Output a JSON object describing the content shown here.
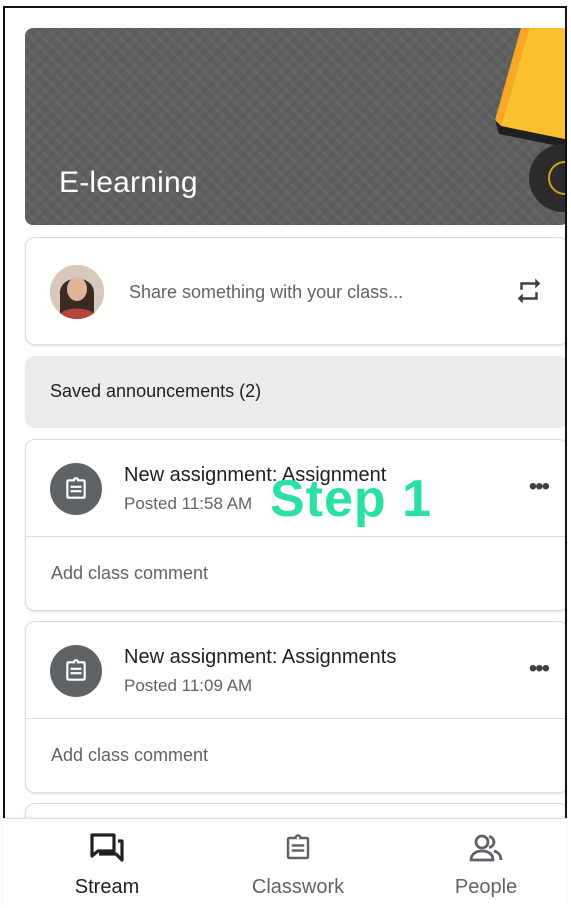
{
  "banner": {
    "title": "E-learning"
  },
  "share": {
    "placeholder": "Share something with your class..."
  },
  "saved": {
    "label": "Saved announcements (2)"
  },
  "posts": [
    {
      "title": "New assignment: Assignment",
      "time": "Posted 11:58 AM",
      "comment": "Add class comment"
    },
    {
      "title": "New assignment: Assignments",
      "time": "Posted 11:09 AM",
      "comment": "Add class comment"
    }
  ],
  "annotation": {
    "step": "Step 1"
  },
  "nav": {
    "stream": "Stream",
    "classwork": "Classwork",
    "people": "People"
  },
  "colors": {
    "banner": "#5f5f5f",
    "accent_yellow": "#fbc02d",
    "step_label": "#2be0a6",
    "icon_dark": "#5f6368"
  }
}
